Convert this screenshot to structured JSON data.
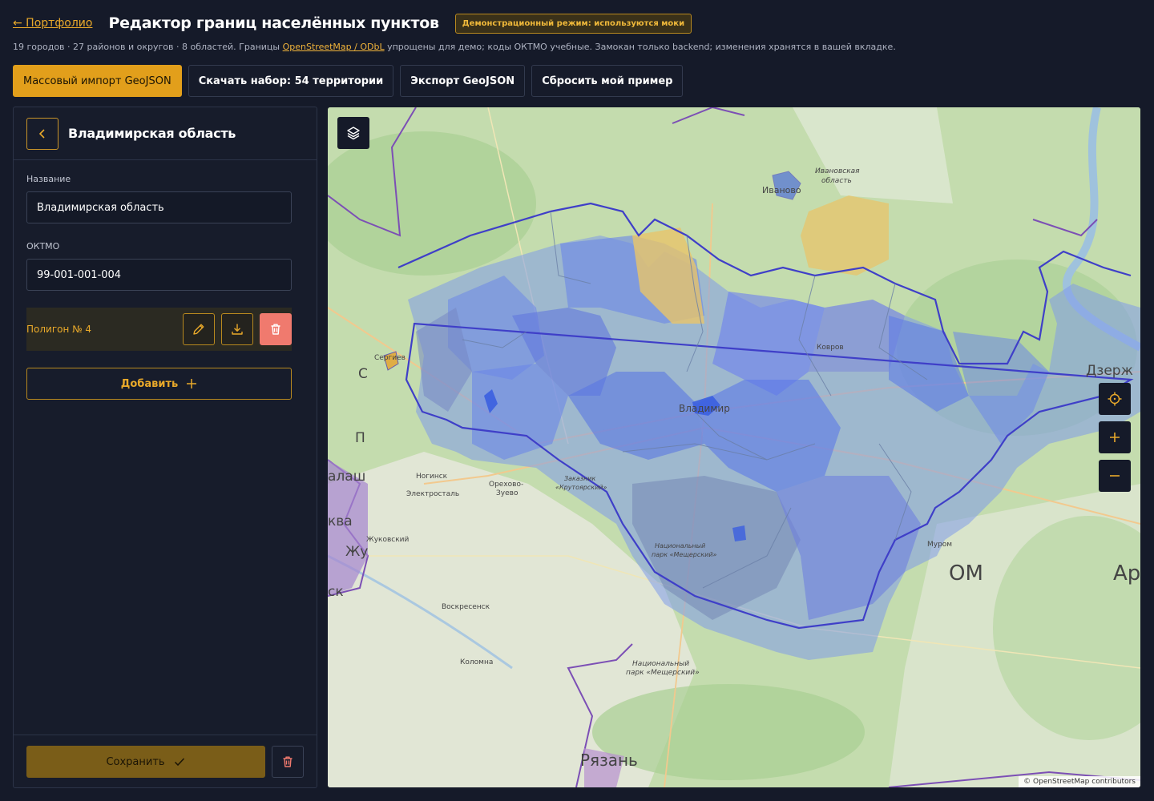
{
  "header": {
    "back_link": "← Портфолио",
    "title": "Редактор границ населённых пунктов",
    "demo_badge": "Демонстрационный режим: используются моки"
  },
  "subtitle": {
    "text_before": "19 городов · 27 районов и округов · 8 областей. Границы ",
    "link": "OpenStreetMap / ODbL",
    "text_after": " упрощены для демо; коды ОКТМО учебные. Замокан только backend; изменения хранятся в вашей вкладке."
  },
  "toolbar": {
    "import_label": "Массовый импорт GeoJSON",
    "download_label": "Скачать набор: 54 территории",
    "export_label": "Экспорт GeoJSON",
    "reset_label": "Сбросить мой пример"
  },
  "sidebar": {
    "title": "Владимирская область",
    "name_label": "Название",
    "name_value": "Владимирская область",
    "oktmo_label": "ОКТМО",
    "oktmo_value": "99-001-001-004",
    "polygon_label": "Полигон № 4",
    "add_label": "Добавить",
    "save_label": "Сохранить"
  },
  "map": {
    "attribution": "© OpenStreetMap contributors",
    "labels": {
      "ivanovo": "Иваново",
      "ivanovo_obl_1": "Ивановская",
      "ivanovo_obl_2": "область",
      "kovrov": "Ковров",
      "vladimir": "Владимир",
      "sergiev": "Сергиев",
      "noginsk": "Ногинск",
      "elektrostal": "Электросталь",
      "orekhovo_1": "Орехово-",
      "orekhovo_2": "Зуево",
      "zakaznik_1": "Заказник",
      "zakaznik_2": "«Крутоярский»",
      "zhukovsky": "Жуковский",
      "voskresensk": "Воскресенск",
      "kolomna": "Коломна",
      "park_1": "Национальный",
      "park_2": "парк «Мещерский»",
      "park_b_1": "Национальный",
      "park_b_2": "парк «Мещерский»",
      "murom": "Муром",
      "dzerzh": "Дзерж",
      "ryazan": "Рязань",
      "edge_s": "С",
      "edge_p": "П",
      "edge_balash": "алаш",
      "edge_kva": "ква",
      "edge_zhu": "Жу",
      "edge_sk": "ск",
      "edge_om": "ОМ",
      "edge_ar": "Ар"
    },
    "colors": {
      "region_fill": "#6b7ff0",
      "region_border": "#3f3fc8",
      "highlight_yellow": "#e8c46a",
      "basemap_green": "#bfd9a8"
    }
  }
}
